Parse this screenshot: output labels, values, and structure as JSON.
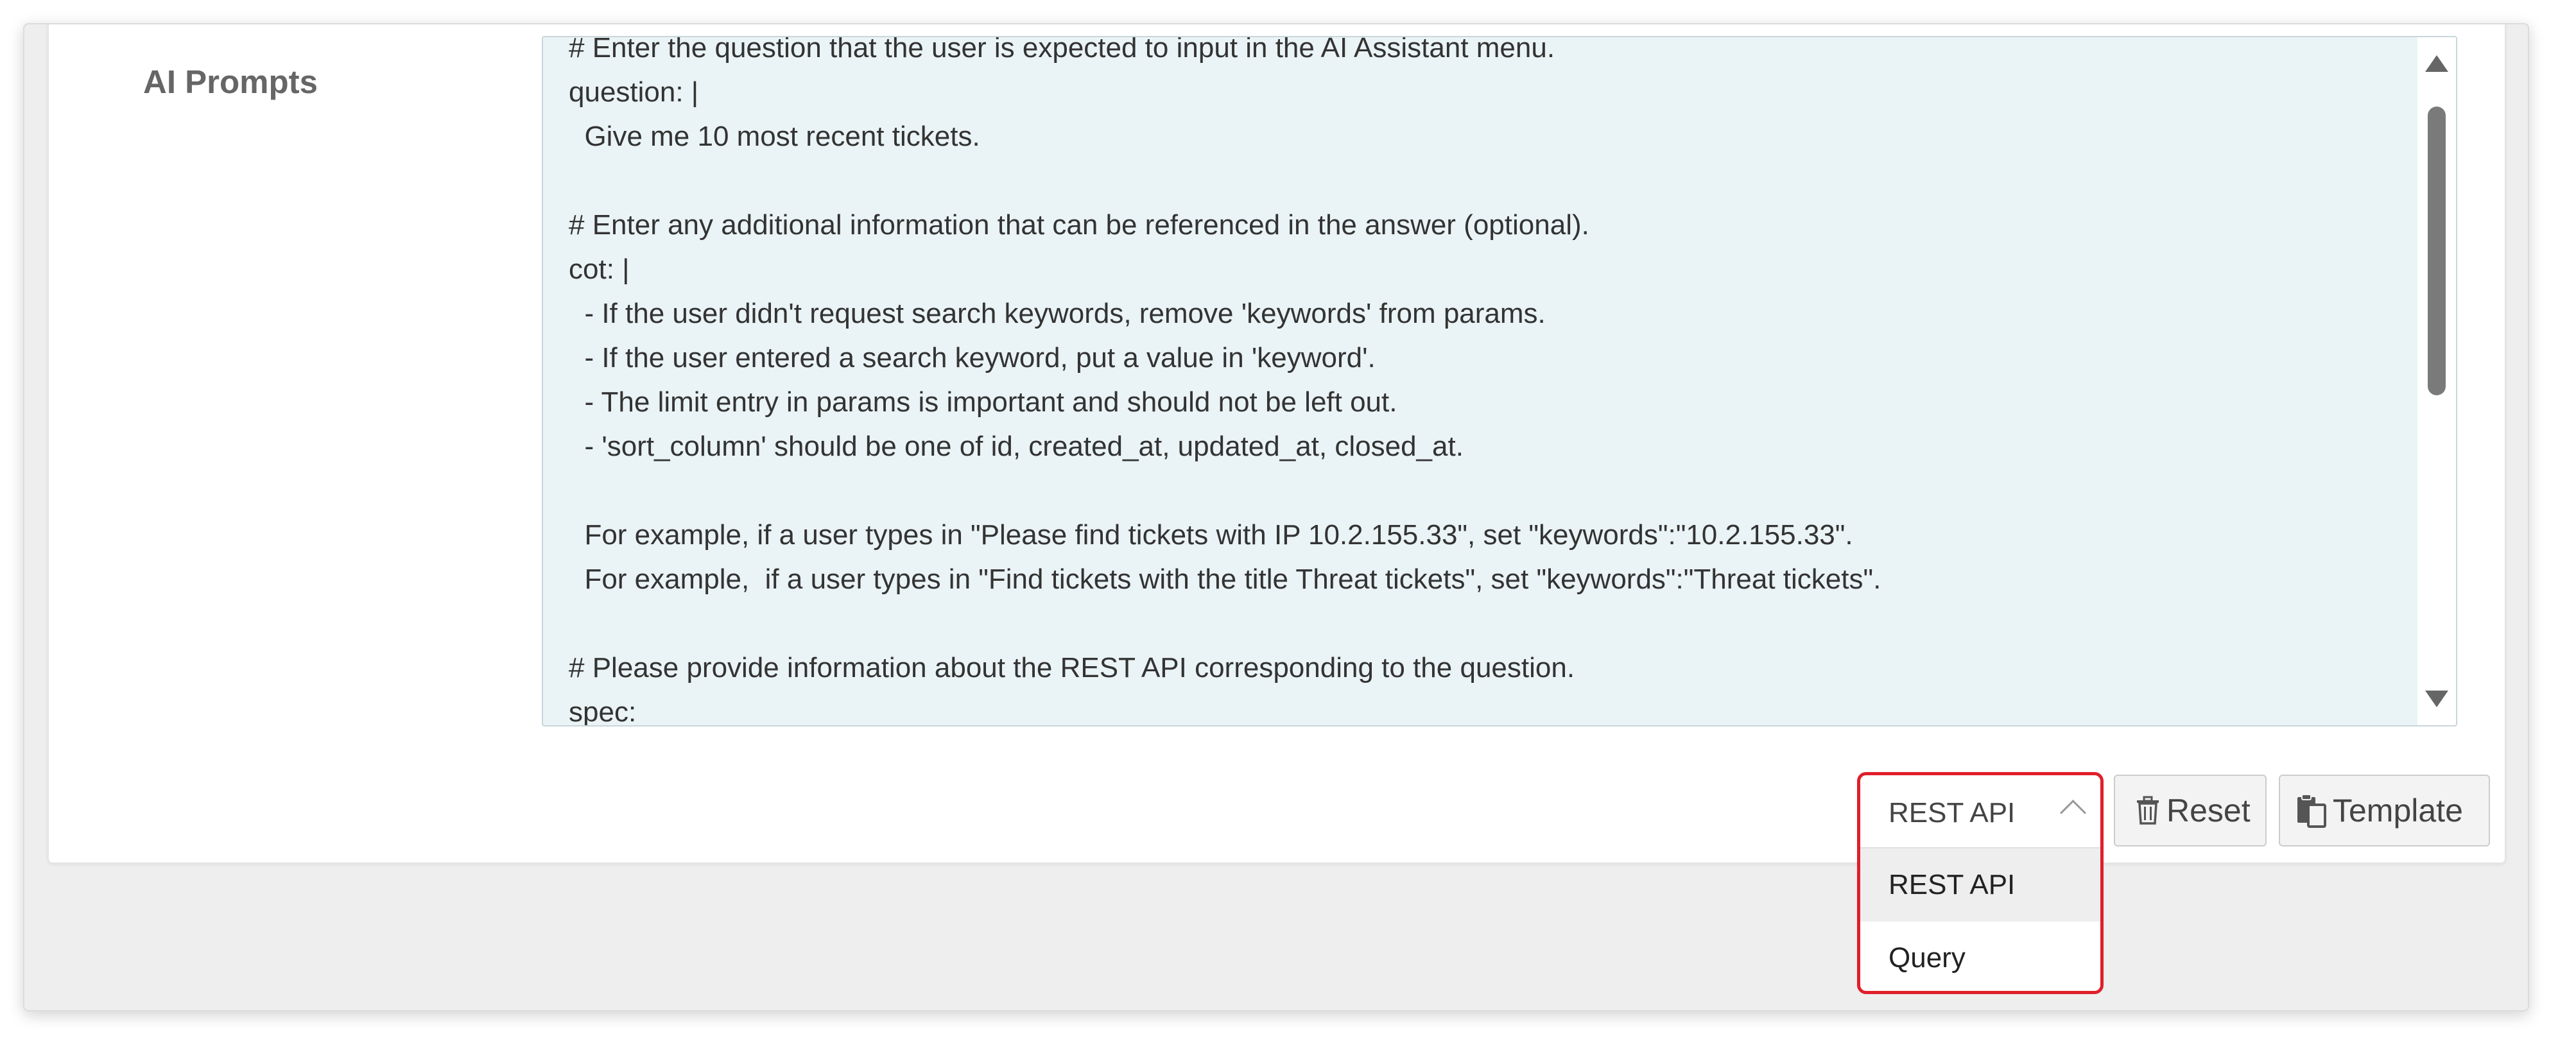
{
  "form": {
    "field_label": "AI Prompts",
    "prompt_lines": [
      "# Enter the question that the user is expected to input in the AI Assistant menu.",
      "question: |",
      "  Give me 10 most recent tickets.",
      "",
      "# Enter any additional information that can be referenced in the answer (optional).",
      "cot: |",
      "  - If the user didn't request search keywords, remove 'keywords' from params.",
      "  - If the user entered a search keyword, put a value in 'keyword'.",
      "  - The limit entry in params is important and should not be left out.",
      "  - 'sort_column' should be one of id, created_at, updated_at, closed_at.",
      "",
      "  For example, if a user types in \"Please find tickets with IP 10.2.155.33\", set \"keywords\":\"10.2.155.33\".",
      "  For example,  if a user types in \"Find tickets with the title Threat tickets\", set \"keywords\":\"Threat tickets\".",
      "",
      "# Please provide information about the REST API corresponding to the question.",
      "spec:"
    ]
  },
  "type_select": {
    "selected": "REST API",
    "expanded": true,
    "options": [
      "REST API",
      "Query"
    ],
    "highlighted_option": "REST API"
  },
  "buttons": {
    "reset_label": "Reset",
    "template_label": "Template"
  },
  "icons": {
    "reset": "trash-icon",
    "template": "paste-icon",
    "select_toggle": "chevron-up-icon"
  },
  "colors": {
    "textarea_bg": "#eaf3f5",
    "dropdown_focus_border": "#e01e2b",
    "label_color": "#666666"
  }
}
